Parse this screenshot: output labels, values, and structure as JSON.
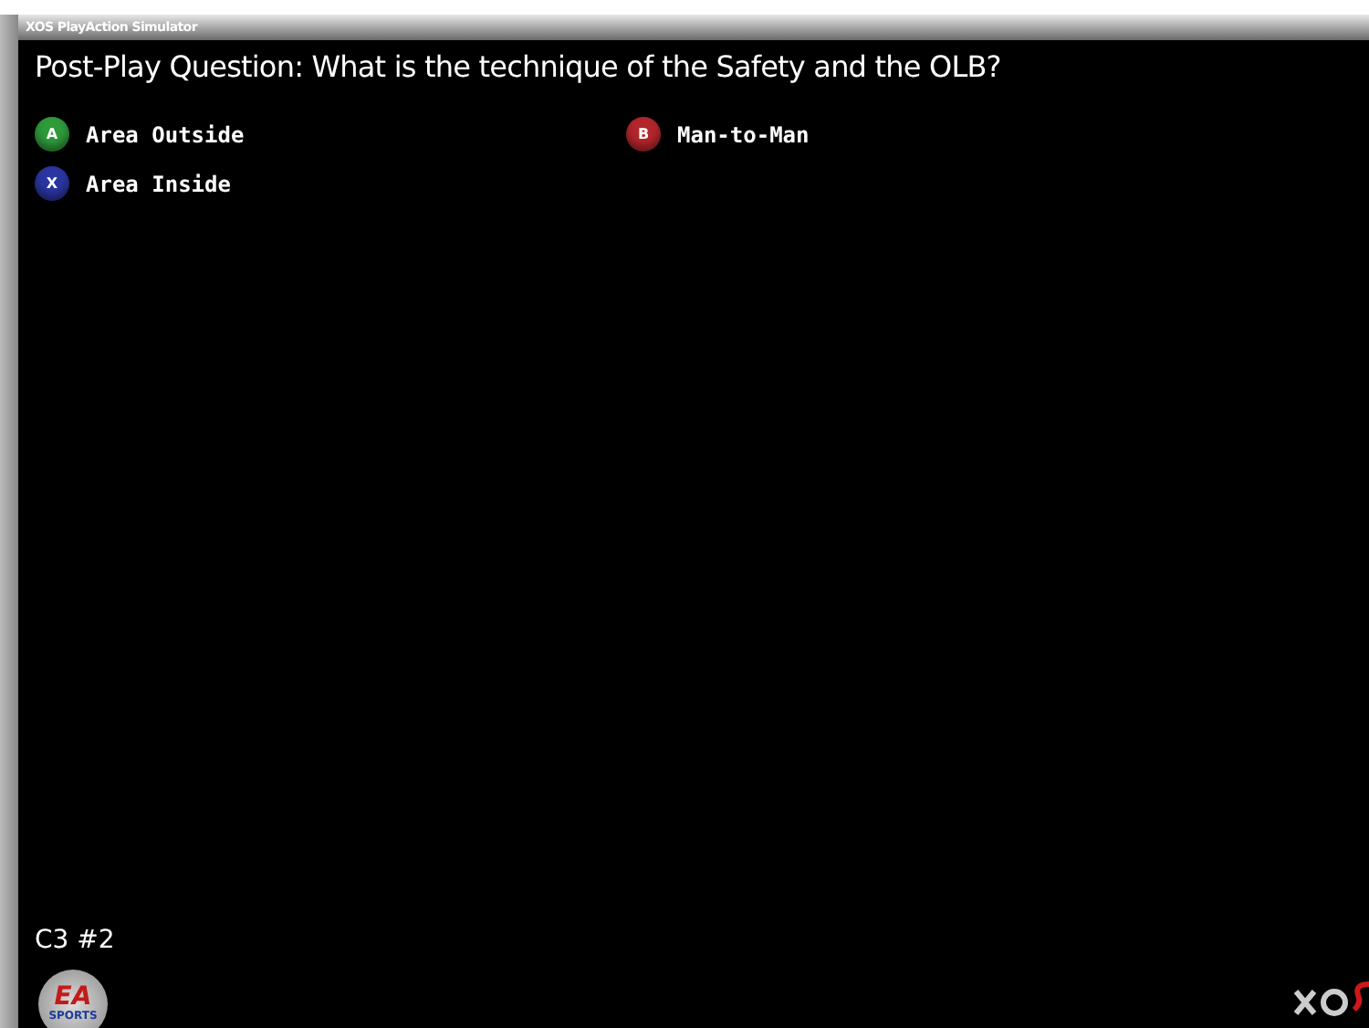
{
  "window": {
    "title": "XOS PlayAction Simulator"
  },
  "question": "Post-Play Question:  What is the technique of the Safety and the OLB?",
  "answers": [
    {
      "button": "A",
      "label": "Area Outside",
      "color": "#2e9a3a"
    },
    {
      "button": "B",
      "label": "Man-to-Man",
      "color": "#b3262b"
    },
    {
      "button": "X",
      "label": "Area Inside",
      "color": "#2b35a0"
    }
  ],
  "play_id": "C3 #2",
  "logo": {
    "top": "EA",
    "bottom": "SPORTS"
  }
}
